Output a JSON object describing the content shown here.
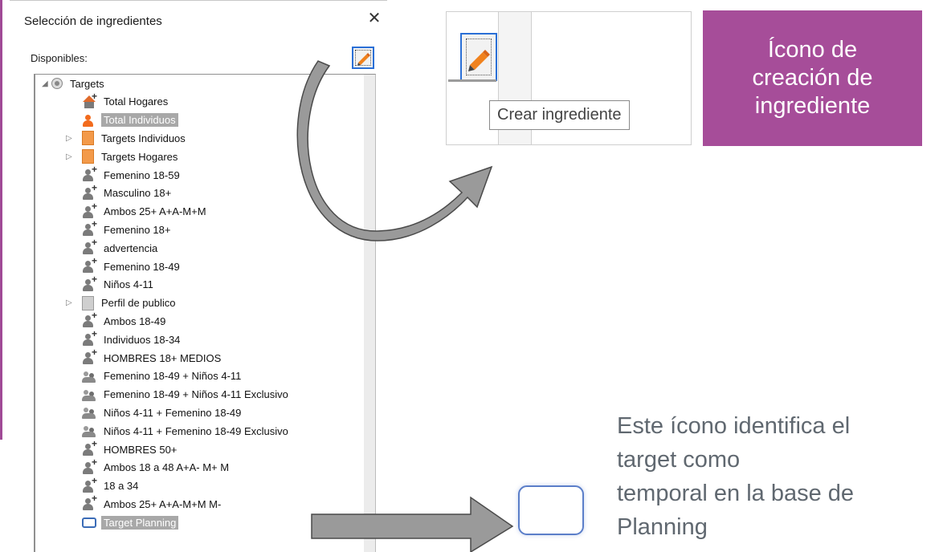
{
  "dialog": {
    "title": "Selección de ingredientes",
    "close_glyph": "✕",
    "available_label": "Disponibles:"
  },
  "tree": [
    {
      "label": "Targets",
      "icon": "radio-icon",
      "expander": "◢",
      "indent": 0,
      "selected": false
    },
    {
      "label": "Total Hogares",
      "icon": "house-icon",
      "expander": "",
      "indent": 1,
      "selected": false
    },
    {
      "label": "Total Individuos",
      "icon": "person-orange-icon",
      "expander": "",
      "indent": 1,
      "selected": true
    },
    {
      "label": "Targets Individuos",
      "icon": "folder-orange-icon",
      "expander": "▷",
      "indent": 1,
      "selected": false
    },
    {
      "label": "Targets Hogares",
      "icon": "folder-orange-icon",
      "expander": "▷",
      "indent": 1,
      "selected": false
    },
    {
      "label": "Femenino 18-59",
      "icon": "person-plus-icon",
      "expander": "",
      "indent": 1,
      "selected": false
    },
    {
      "label": "Masculino 18+",
      "icon": "person-plus-icon",
      "expander": "",
      "indent": 1,
      "selected": false
    },
    {
      "label": "Ambos 25+ A+A-M+M",
      "icon": "person-plus-icon",
      "expander": "",
      "indent": 1,
      "selected": false
    },
    {
      "label": "Femenino 18+",
      "icon": "person-plus-icon",
      "expander": "",
      "indent": 1,
      "selected": false
    },
    {
      "label": "advertencia",
      "icon": "person-plus-icon",
      "expander": "",
      "indent": 1,
      "selected": false
    },
    {
      "label": "Femenino 18-49",
      "icon": "person-plus-icon",
      "expander": "",
      "indent": 1,
      "selected": false
    },
    {
      "label": "Niños 4-11",
      "icon": "person-plus-icon",
      "expander": "",
      "indent": 1,
      "selected": false
    },
    {
      "label": "Perfil de publico",
      "icon": "folder-gray-icon",
      "expander": "▷",
      "indent": 1,
      "selected": false
    },
    {
      "label": "Ambos 18-49",
      "icon": "person-plus-icon",
      "expander": "",
      "indent": 1,
      "selected": false
    },
    {
      "label": "Individuos 18-34",
      "icon": "person-plus-icon",
      "expander": "",
      "indent": 1,
      "selected": false
    },
    {
      "label": "HOMBRES 18+ MEDIOS",
      "icon": "person-plus-icon",
      "expander": "",
      "indent": 1,
      "selected": false
    },
    {
      "label": "Femenino 18-49 + Niños 4-11",
      "icon": "group-icon",
      "expander": "",
      "indent": 1,
      "selected": false
    },
    {
      "label": "Femenino 18-49 + Niños 4-11 Exclusivo",
      "icon": "group-icon",
      "expander": "",
      "indent": 1,
      "selected": false
    },
    {
      "label": "Niños 4-11 + Femenino 18-49",
      "icon": "group-icon",
      "expander": "",
      "indent": 1,
      "selected": false
    },
    {
      "label": "Niños 4-11 + Femenino 18-49 Exclusivo",
      "icon": "group-icon",
      "expander": "",
      "indent": 1,
      "selected": false
    },
    {
      "label": "HOMBRES 50+",
      "icon": "person-plus-icon",
      "expander": "",
      "indent": 1,
      "selected": false
    },
    {
      "label": "Ambos 18 a 48 A+A- M+ M",
      "icon": "person-plus-icon",
      "expander": "",
      "indent": 1,
      "selected": false
    },
    {
      "label": "18 a 34",
      "icon": "person-plus-icon",
      "expander": "",
      "indent": 1,
      "selected": false
    },
    {
      "label": "Ambos 25+  A+A-M+M M-",
      "icon": "person-plus-icon",
      "expander": "",
      "indent": 1,
      "selected": false
    },
    {
      "label": "Target Planning",
      "icon": "temporary-target-icon",
      "expander": "",
      "indent": 1,
      "selected": true
    }
  ],
  "inset": {
    "tooltip": "Crear ingrediente"
  },
  "callout": {
    "lines": [
      "Ícono de",
      "creación de",
      "ingrediente"
    ]
  },
  "description": {
    "lines": [
      "Este ícono identifica el",
      "target como",
      "temporal en la base de",
      "Planning"
    ]
  },
  "colors": {
    "accent_purple": "#a64d99",
    "pencil_orange": "#f0821e",
    "selection_gray": "#a8a8a8",
    "focus_blue": "#2a6fd6"
  }
}
